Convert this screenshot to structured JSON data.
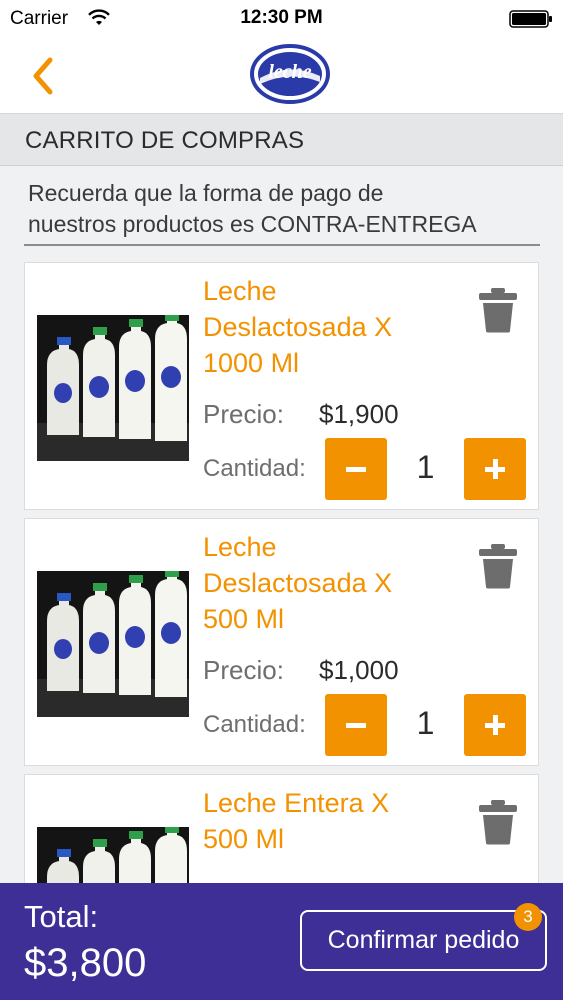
{
  "status_bar": {
    "carrier": "Carrier",
    "time": "12:30 PM"
  },
  "nav": {
    "back_icon": "chevron-left-icon",
    "logo_alt": "Valle Leche"
  },
  "section": {
    "title": "CARRITO DE COMPRAS"
  },
  "notice": {
    "line1": "Recuerda que la forma de pago de",
    "line2": "nuestros productos es CONTRA-ENTREGA"
  },
  "cart": {
    "price_label": "Precio:",
    "quantity_label": "Cantidad:",
    "items": [
      {
        "name_line1": "Leche",
        "name_line2": "Deslactosada X",
        "name_line3": "1000 Ml",
        "price": "$1,900",
        "quantity": "1"
      },
      {
        "name_line1": "Leche",
        "name_line2": "Deslactosada X",
        "name_line3": "500 Ml",
        "price": "$1,000",
        "quantity": "1"
      },
      {
        "name_line1": "Leche Entera X",
        "name_line2": "500 Ml",
        "name_line3": ""
      }
    ]
  },
  "footer": {
    "total_label": "Total:",
    "total_value": "$3,800",
    "confirm_label": "Confirmar pedido",
    "badge_count": "3"
  },
  "colors": {
    "accent": "#f39200",
    "footer_bg": "#3e2f97",
    "header_bg": "#e5e6e8"
  }
}
